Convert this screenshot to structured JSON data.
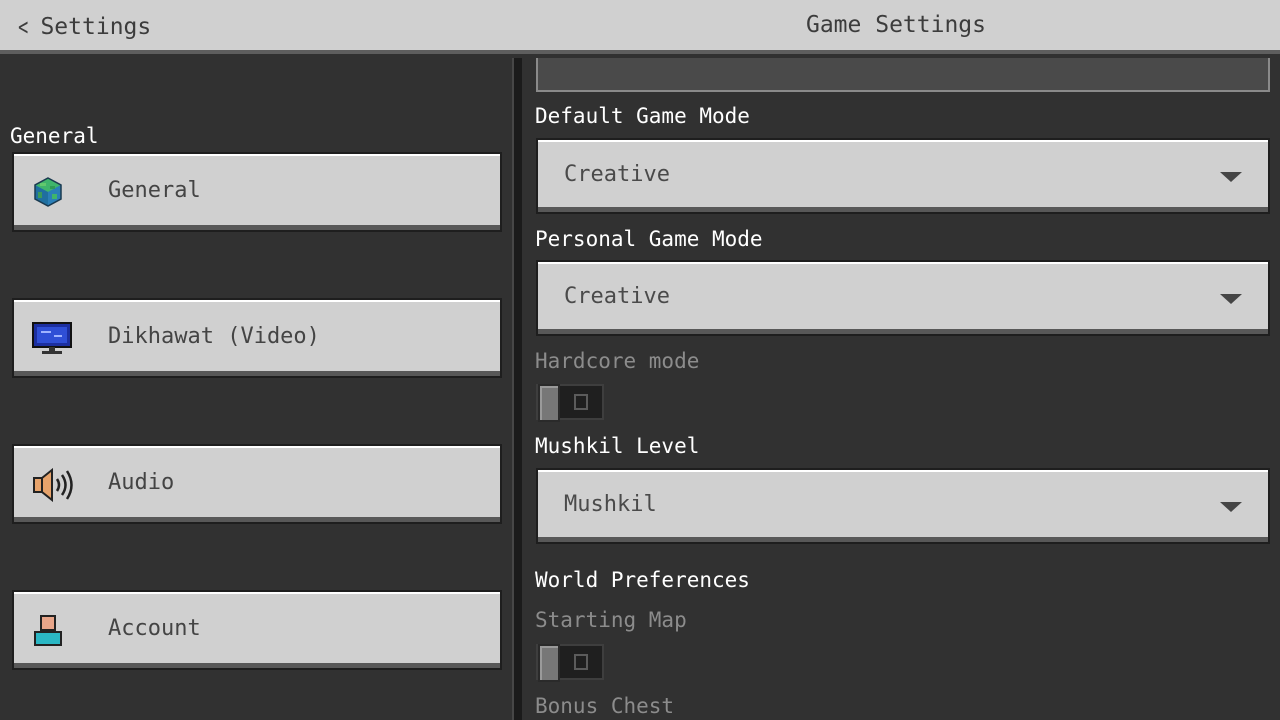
{
  "header": {
    "back_label": "Settings",
    "title": "Game Settings"
  },
  "sidebar": {
    "section_heading": "General",
    "items": [
      {
        "label": "General",
        "icon": "globe-icon"
      },
      {
        "label": "Dikhawat (Video)",
        "icon": "monitor-icon"
      },
      {
        "label": "Audio",
        "icon": "speaker-icon"
      },
      {
        "label": "Account",
        "icon": "person-icon"
      }
    ]
  },
  "settings": {
    "default_game_mode": {
      "label": "Default Game Mode",
      "value": "Creative"
    },
    "personal_game_mode": {
      "label": "Personal Game Mode",
      "value": "Creative"
    },
    "hardcore_mode": {
      "label": "Hardcore mode",
      "enabled": false
    },
    "difficulty": {
      "label": "Mushkil Level",
      "value": "Mushkil"
    },
    "world_preferences": {
      "heading": "World Preferences",
      "starting_map": {
        "label": "Starting Map",
        "enabled": false
      },
      "bonus_chest": {
        "label": "Bonus Chest"
      }
    }
  },
  "colors": {
    "panel_bg": "#313131",
    "button_bg": "#d0d0d0",
    "header_bg": "#d0d0d0",
    "label_white": "#ffffff",
    "label_disabled": "#8c8c8c"
  }
}
